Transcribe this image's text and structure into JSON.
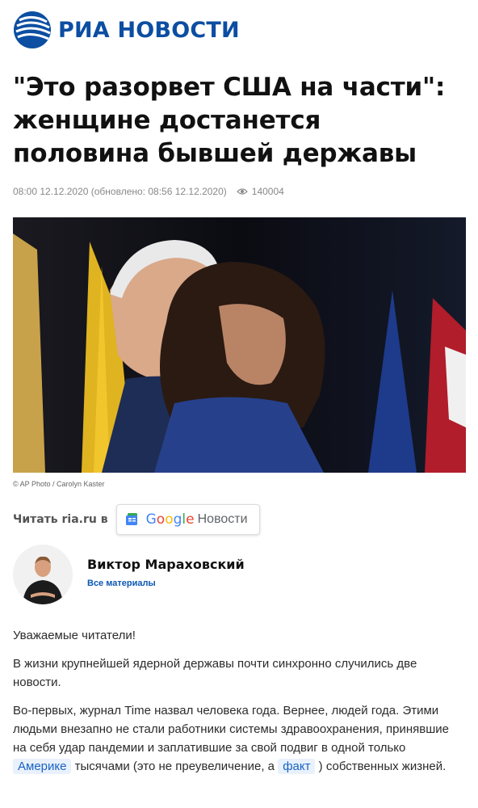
{
  "brand": {
    "name": "РИА НОВОСТИ",
    "color": "#0b4ea2"
  },
  "article": {
    "title": "\"Это разорвет США на части\": женщине достанется половина бывшей державы",
    "published": "08:00 12.12.2020",
    "updated": "(обновлено: 08:56 12.12.2020)",
    "views": "140004",
    "photo_credit": "© AP Photo / Carolyn Kaster"
  },
  "google_news": {
    "read_label": "Читать ria.ru в",
    "google_word": "Google",
    "suffix": "Новости",
    "google_colors": [
      "#4285F4",
      "#EA4335",
      "#FBBC05",
      "#4285F4",
      "#34A853",
      "#EA4335"
    ]
  },
  "author": {
    "name": "Виктор Мараховский",
    "all_materials": "Все материалы"
  },
  "body": {
    "p1": "Уважаемые читатели!",
    "p2": "В жизни крупнейшей ядерной державы почти синхронно случились две новости.",
    "p3_a": "Во-первых, журнал Time назвал человека года. Вернее, людей года. Этими людьми внезапно не стали работники системы здравоохранения, принявшие на себя удар пандемии и заплатившие за свой подвиг в одной только",
    "p3_tag1": "Америке",
    "p3_b": "тысячами (это не преувеличение, а",
    "p3_tag2": "факт",
    "p3_c": ") собственных жизней."
  }
}
